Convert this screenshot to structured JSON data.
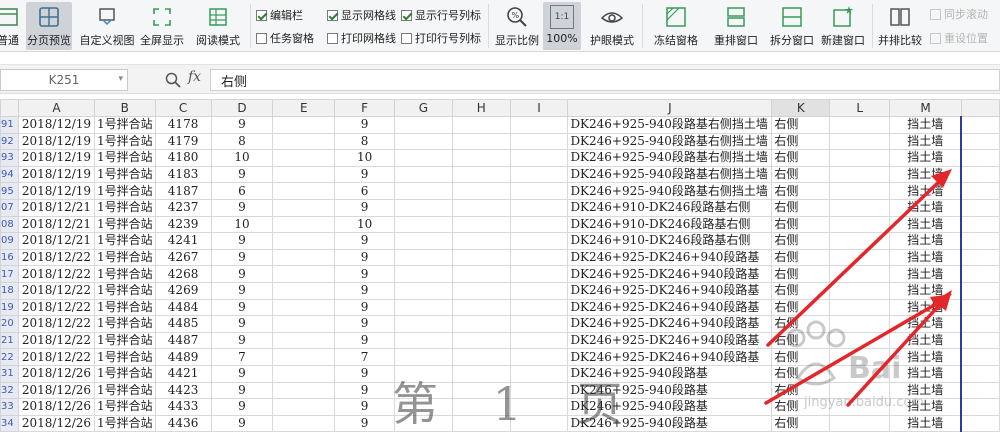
{
  "ribbon": {
    "buttons": [
      {
        "name": "normal-view-button",
        "label": "普通",
        "icon": "normal-view-icon"
      },
      {
        "name": "page-break-preview-button",
        "label": "分页预览",
        "icon": "page-break-icon",
        "active": true
      },
      {
        "name": "custom-view-button",
        "label": "自定义视图",
        "icon": "custom-view-icon"
      },
      {
        "name": "full-screen-button",
        "label": "全屏显示",
        "icon": "full-screen-icon"
      },
      {
        "name": "reading-mode-button",
        "label": "阅读模式",
        "icon": "reading-mode-icon"
      },
      {
        "name": "zoom-ratio-button",
        "label": "显示比例",
        "icon": "zoom-icon"
      },
      {
        "name": "zoom-100-button",
        "label": "100%",
        "icon_text": "1:1",
        "icon": "one-to-one-icon",
        "active": true
      },
      {
        "name": "eye-protection-button",
        "label": "护眼模式",
        "icon": "eye-icon"
      },
      {
        "name": "freeze-panes-button",
        "label": "冻结窗格",
        "icon": "freeze-icon"
      },
      {
        "name": "rearrange-windows-button",
        "label": "重排窗口",
        "icon": "rearrange-icon"
      },
      {
        "name": "split-window-button",
        "label": "拆分窗口",
        "icon": "split-icon"
      },
      {
        "name": "new-window-button",
        "label": "新建窗口",
        "icon": "new-window-icon"
      },
      {
        "name": "side-by-side-button",
        "label": "并排比较",
        "icon": "side-by-side-icon"
      }
    ],
    "checks": {
      "formula_bar": {
        "label": "编辑栏",
        "checked": true
      },
      "gridlines": {
        "label": "显示网格线",
        "checked": true
      },
      "headings": {
        "label": "显示行号列标",
        "checked": true
      },
      "task_pane": {
        "label": "任务窗格",
        "checked": false
      },
      "print_gridlines": {
        "label": "打印网格线",
        "checked": false
      },
      "print_headings": {
        "label": "打印行号列标",
        "checked": false
      }
    },
    "sync_scroll": "同步滚动",
    "reset_position": "重设位置"
  },
  "formula_bar": {
    "cell_ref": "K251",
    "fx": "fx",
    "value": "右侧"
  },
  "columns": [
    "A",
    "B",
    "C",
    "D",
    "E",
    "F",
    "G",
    "H",
    "I",
    "J",
    "K",
    "L",
    "M"
  ],
  "rows": [
    {
      "n": "91",
      "a": "2018/12/19",
      "b": "1号拌合站",
      "c": "4178",
      "d": "9",
      "f": "9",
      "j": "DK246+925-940段路基右侧挡土墙",
      "k": "右侧",
      "m": "挡土墙"
    },
    {
      "n": "92",
      "a": "2018/12/19",
      "b": "1号拌合站",
      "c": "4179",
      "d": "8",
      "f": "8",
      "j": "DK246+925-940段路基右侧挡土墙",
      "k": "右侧",
      "m": "挡土墙"
    },
    {
      "n": "93",
      "a": "2018/12/19",
      "b": "1号拌合站",
      "c": "4180",
      "d": "10",
      "f": "10",
      "j": "DK246+925-940段路基右侧挡土墙",
      "k": "右侧",
      "m": "挡土墙"
    },
    {
      "n": "94",
      "a": "2018/12/19",
      "b": "1号拌合站",
      "c": "4183",
      "d": "9",
      "f": "9",
      "j": "DK246+925-940段路基右侧挡土墙",
      "k": "右侧",
      "m": "挡土墙"
    },
    {
      "n": "95",
      "a": "2018/12/19",
      "b": "1号拌合站",
      "c": "4187",
      "d": "6",
      "f": "6",
      "j": "DK246+925-940段路基右侧挡土墙",
      "k": "右侧",
      "m": "挡土墙"
    },
    {
      "n": "07",
      "a": "2018/12/21",
      "b": "1号拌合站",
      "c": "4237",
      "d": "9",
      "f": "9",
      "j": "DK246+910-DK246段路基右侧",
      "k": "右侧",
      "m": "挡土墙"
    },
    {
      "n": "08",
      "a": "2018/12/21",
      "b": "1号拌合站",
      "c": "4239",
      "d": "10",
      "f": "10",
      "j": "DK246+910-DK246段路基右侧",
      "k": "右侧",
      "m": "挡土墙"
    },
    {
      "n": "09",
      "a": "2018/12/21",
      "b": "1号拌合站",
      "c": "4241",
      "d": "9",
      "f": "9",
      "j": "DK246+910-DK246段路基右侧",
      "k": "右侧",
      "m": "挡土墙"
    },
    {
      "n": "16",
      "a": "2018/12/22",
      "b": "1号拌合站",
      "c": "4267",
      "d": "9",
      "f": "9",
      "j": "DK246+925-DK246+940段路基",
      "k": "右侧",
      "m": "挡土墙"
    },
    {
      "n": "17",
      "a": "2018/12/22",
      "b": "1号拌合站",
      "c": "4268",
      "d": "9",
      "f": "9",
      "j": "DK246+925-DK246+940段路基",
      "k": "右侧",
      "m": "挡土墙"
    },
    {
      "n": "18",
      "a": "2018/12/22",
      "b": "1号拌合站",
      "c": "4269",
      "d": "9",
      "f": "9",
      "j": "DK246+925-DK246+940段路基",
      "k": "右侧",
      "m": "挡土墙"
    },
    {
      "n": "19",
      "a": "2018/12/22",
      "b": "1号拌合站",
      "c": "4484",
      "d": "9",
      "f": "9",
      "j": "DK246+925-DK246+940段路基",
      "k": "右侧",
      "m": "挡土墙"
    },
    {
      "n": "20",
      "a": "2018/12/22",
      "b": "1号拌合站",
      "c": "4485",
      "d": "9",
      "f": "9",
      "j": "DK246+925-DK246+940段路基",
      "k": "右侧",
      "m": "挡土墙"
    },
    {
      "n": "21",
      "a": "2018/12/22",
      "b": "1号拌合站",
      "c": "4487",
      "d": "9",
      "f": "9",
      "j": "DK246+925-DK246+940段路基",
      "k": "右侧",
      "m": "挡土墙"
    },
    {
      "n": "22",
      "a": "2018/12/22",
      "b": "1号拌合站",
      "c": "4489",
      "d": "7",
      "f": "7",
      "j": "DK246+925-DK246+940段路基",
      "k": "右侧",
      "m": "挡土墙"
    },
    {
      "n": "31",
      "a": "2018/12/26",
      "b": "1号拌合站",
      "c": "4421",
      "d": "9",
      "f": "9",
      "j": "DK246+925-940段路基",
      "k": "右侧",
      "m": "挡土墙"
    },
    {
      "n": "32",
      "a": "2018/12/26",
      "b": "1号拌合站",
      "c": "4423",
      "d": "9",
      "f": "9",
      "j": "DK246+925-940段路基",
      "k": "右侧",
      "m": "挡土墙"
    },
    {
      "n": "33",
      "a": "2018/12/26",
      "b": "1号拌合站",
      "c": "4433",
      "d": "9",
      "f": "9",
      "j": "DK246+925-940段路基",
      "k": "右侧",
      "m": "挡土墙"
    },
    {
      "n": "34",
      "a": "2018/12/26",
      "b": "1号拌合站",
      "c": "4436",
      "d": "9",
      "f": "9",
      "j": "DK246+925-940段路基",
      "k": "右侧",
      "m": "挡土墙"
    }
  ],
  "watermark": "第 1 页",
  "colors": {
    "arrow": "#e3262a",
    "row_header_text": "#3e5bb4",
    "print_border": "#2b3f9a"
  }
}
